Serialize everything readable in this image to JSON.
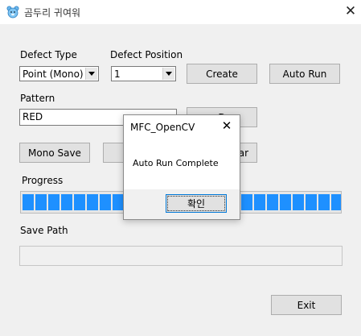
{
  "window": {
    "title": "곰두리 귀여워",
    "close_glyph": "✕"
  },
  "defect_type": {
    "label": "Defect Type",
    "selected": "Point (Mono)"
  },
  "defect_position": {
    "label": "Defect Position",
    "selected": "1"
  },
  "buttons": {
    "create": "Create",
    "auto_run": "Auto Run",
    "mono_save": "Mono Save",
    "c_partial": "C",
    "partial_right": "D",
    "clear_partial": "ear",
    "exit": "Exit"
  },
  "pattern": {
    "label": "Pattern",
    "value": "RED"
  },
  "progress": {
    "label": "Progress",
    "fraction": 1.0,
    "chunk_count": 25,
    "color": "#1e90ff"
  },
  "save_path": {
    "label": "Save Path",
    "value": ""
  },
  "dialog": {
    "title": "MFC_OpenCV",
    "close_glyph": "✕",
    "message": "Auto Run Complete",
    "ok_label": "확인"
  }
}
